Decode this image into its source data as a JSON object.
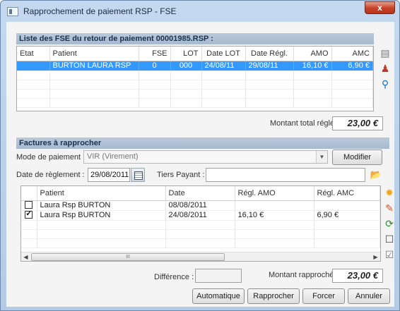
{
  "window": {
    "title": "Rapprochement de paiement RSP - FSE",
    "close_label": "x"
  },
  "fse_section": {
    "header": "Liste des FSE du retour de paiement 00001985.RSP :",
    "columns": [
      "Etat",
      "Patient",
      "FSE",
      "LOT",
      "Date LOT",
      "Date Régl.",
      "AMO",
      "AMC"
    ],
    "rows": [
      {
        "etat": "",
        "patient": "BURTON LAURA RSP",
        "fse": "0",
        "lot": "000",
        "date_lot": "24/08/11",
        "date_regl": "29/08/11",
        "amo": "16,10 €",
        "amc": "6,90 €",
        "selected": true
      }
    ],
    "total_label": "Montant total réglé :",
    "total_value": "23,00 €"
  },
  "factures_section": {
    "header": "Factures à rapprocher",
    "mode_label": "Mode de paiement :",
    "mode_value": "VIR  (Virement)",
    "modifier_label": "Modifier",
    "date_label": "Date de règlement :",
    "date_value": "29/08/2011",
    "tiers_label": "Tiers Payant :",
    "tiers_value": "",
    "columns": [
      "",
      "Patient",
      "Date",
      "Régl. AMO",
      "Régl. AMC"
    ],
    "rows": [
      {
        "checked": false,
        "patient": "Laura Rsp BURTON",
        "date": "08/08/2011",
        "amo": "",
        "amc": ""
      },
      {
        "checked": true,
        "patient": "Laura Rsp BURTON",
        "date": "24/08/2011",
        "amo": "16,10 €",
        "amc": "6,90 €"
      }
    ],
    "scroll_thumb": "III",
    "difference_label": "Différence :",
    "difference_value": "",
    "rapproche_label": "Montant rapproché :",
    "rapproche_value": "23,00 €"
  },
  "buttons": {
    "automatique": "Automatique",
    "rapprocher": "Rapprocher",
    "forcer": "Forcer",
    "annuler": "Annuler"
  },
  "icons": {
    "fse_side": [
      "document-preview-icon",
      "user-refresh-icon",
      "search-icon"
    ],
    "factures_side": [
      "new-star-icon",
      "edit-pencil-icon",
      "refresh-icon",
      "uncheck-all-icon",
      "check-all-icon"
    ]
  }
}
